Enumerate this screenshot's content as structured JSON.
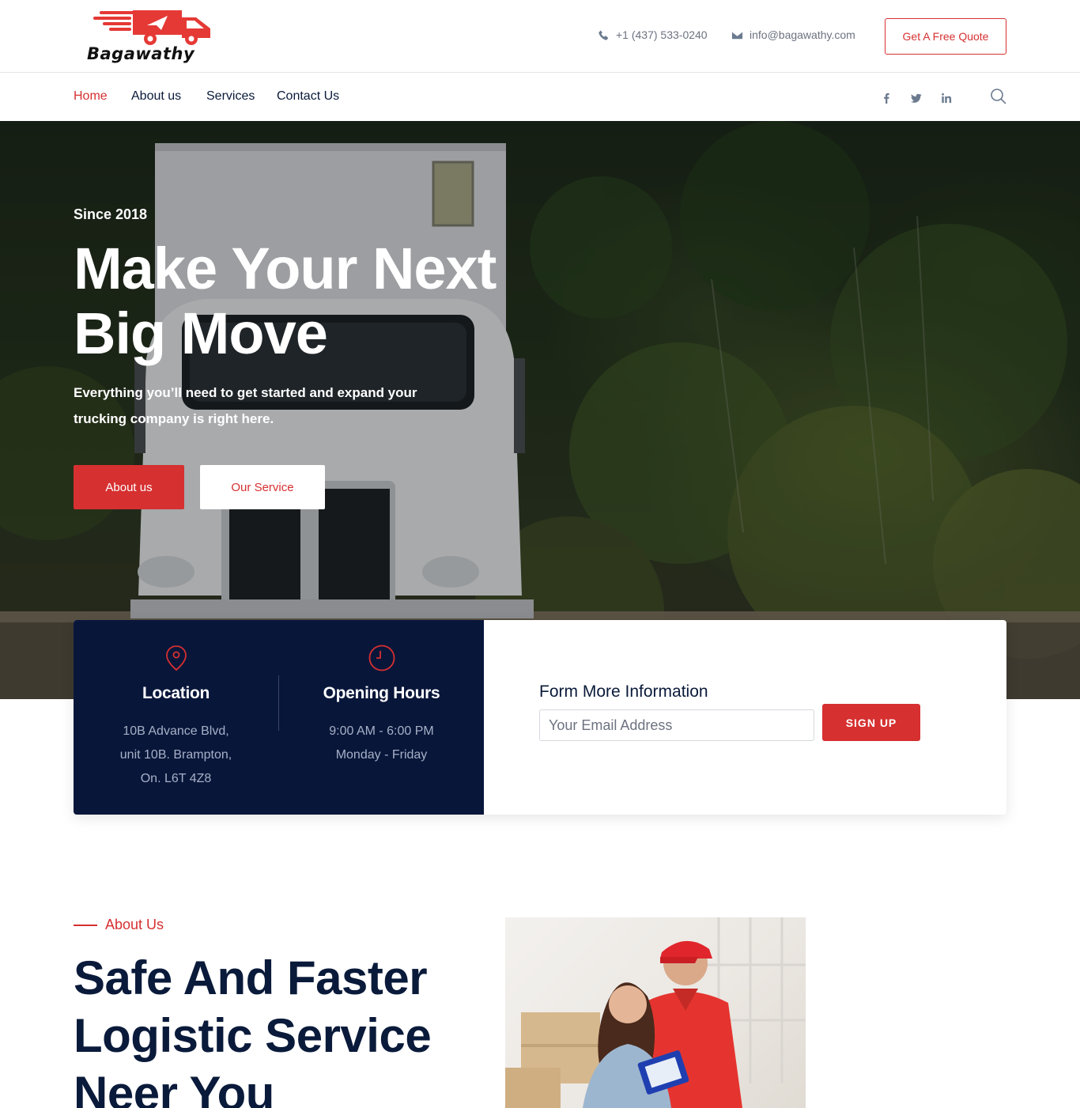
{
  "brand": {
    "name": "Bagawathy"
  },
  "header": {
    "phone": "+1 (437) 533-0240",
    "email": "info@bagawathy.com",
    "quote_label": "Get A Free Quote"
  },
  "nav": {
    "items": [
      {
        "label": "Home"
      },
      {
        "label": "About us"
      },
      {
        "label": "Services"
      },
      {
        "label": "Contact Us"
      }
    ]
  },
  "hero": {
    "eyebrow": "Since 2018",
    "title_line1": "Make Your Next",
    "title_line2": "Big Move",
    "subtitle": "Everything you’ll need to get started and expand your trucking company is right here.",
    "btn_primary": "About us",
    "btn_secondary": "Our Service"
  },
  "info": {
    "location": {
      "title": "Location",
      "line1": "10B Advance Blvd,",
      "line2": "unit 10B. Brampton,",
      "line3": "On. L6T 4Z8"
    },
    "hours": {
      "title": "Opening Hours",
      "line1": "9:00 AM - 6:00 PM",
      "line2": "Monday - Friday"
    },
    "form": {
      "title": "Form More Information",
      "placeholder": "Your Email Address",
      "button": "SIGN UP"
    }
  },
  "about": {
    "label": "About Us",
    "title_line1": "Safe And Faster",
    "title_line2": "Logistic Service",
    "title_line3": "Neer You"
  },
  "colors": {
    "accent": "#d63031",
    "navy": "#08163a",
    "text": "#0a1a3a"
  }
}
